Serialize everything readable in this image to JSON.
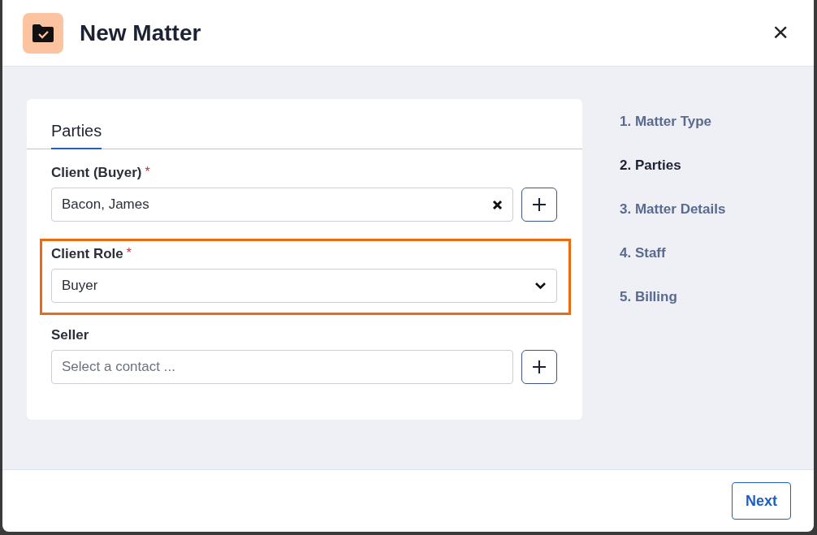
{
  "dialog": {
    "title": "New Matter",
    "close_label": "×"
  },
  "card": {
    "tabs": [
      {
        "label": "Parties",
        "selected": true
      }
    ],
    "fields": [
      {
        "kind": "contact",
        "label": "Client (Buyer)",
        "required_mark": "*",
        "highlighted": false,
        "value": "Bacon, James"
      },
      {
        "kind": "select",
        "label": "Client Role",
        "required_mark": "*",
        "highlighted": true,
        "value": "Buyer"
      },
      {
        "kind": "contact",
        "label": "Seller",
        "highlighted": false,
        "placeholder": "Select a contact ..."
      }
    ]
  },
  "steps": [
    {
      "label": "1. Matter Type",
      "selected": false
    },
    {
      "label": "2. Parties",
      "selected": true
    },
    {
      "label": "3. Matter Details",
      "selected": false
    },
    {
      "label": "4. Staff",
      "selected": false
    },
    {
      "label": "5. Billing",
      "selected": false
    }
  ],
  "footer": {
    "buttons": [
      "Next"
    ]
  }
}
